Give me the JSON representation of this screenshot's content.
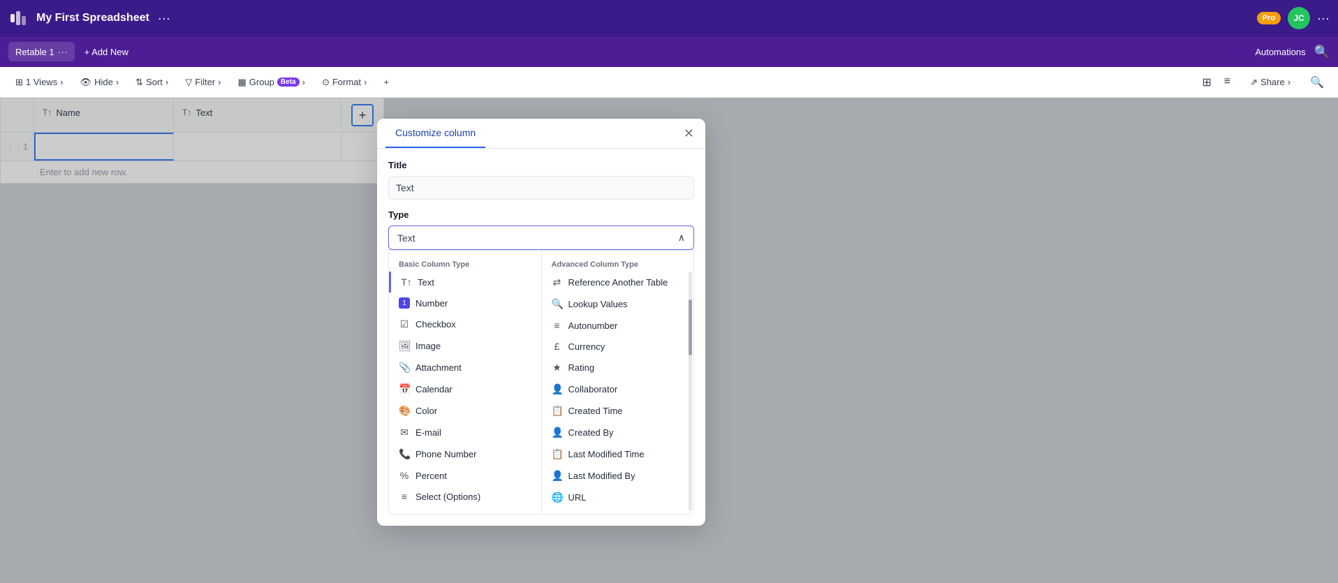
{
  "app": {
    "title": "My First Spreadsheet",
    "dots_label": "···",
    "logo_alt": "Retable logo"
  },
  "topbar": {
    "pro_badge": "Pro",
    "avatar_initials": "JC",
    "more_dots": "···"
  },
  "tabs": {
    "current_tab": "Retable 1",
    "current_tab_dots": "···",
    "add_new": "+ Add New",
    "automations": "Automations"
  },
  "toolbar": {
    "views": "1 Views",
    "hide": "Hide",
    "sort": "Sort",
    "filter": "Filter",
    "group": "Group",
    "group_badge": "Beta",
    "format": "Format",
    "add_icon": "+",
    "share": "Share"
  },
  "table": {
    "col_name": "Name",
    "col_text": "Text",
    "add_col_label": "+",
    "row_number": "1",
    "add_row_hint": "Enter to add new row."
  },
  "modal": {
    "tab_label": "Customize column",
    "close_icon": "✕",
    "title_label": "Title",
    "title_value": "Text",
    "type_label": "Type",
    "type_value": "Text",
    "chevron_up": "∧",
    "basic_section_title": "Basic Column Type",
    "advanced_section_title": "Advanced Column Type",
    "basic_items": [
      {
        "icon": "T↑",
        "label": "Text",
        "active": true
      },
      {
        "icon": "1",
        "label": "Number"
      },
      {
        "icon": "✓",
        "label": "Checkbox"
      },
      {
        "icon": "🖼",
        "label": "Image"
      },
      {
        "icon": "📎",
        "label": "Attachment"
      },
      {
        "icon": "📅",
        "label": "Calendar"
      },
      {
        "icon": "🎨",
        "label": "Color"
      },
      {
        "icon": "✉",
        "label": "E-mail"
      },
      {
        "icon": "📞",
        "label": "Phone Number"
      },
      {
        "icon": "%",
        "label": "Percent"
      },
      {
        "icon": "≡",
        "label": "Select (Options)"
      }
    ],
    "advanced_items": [
      {
        "icon": "⇄",
        "label": "Reference Another Table"
      },
      {
        "icon": "🔍",
        "label": "Lookup Values"
      },
      {
        "icon": "#",
        "label": "Autonumber"
      },
      {
        "icon": "£",
        "label": "Currency"
      },
      {
        "icon": "★",
        "label": "Rating"
      },
      {
        "icon": "👤",
        "label": "Collaborator"
      },
      {
        "icon": "📋",
        "label": "Created Time"
      },
      {
        "icon": "👤",
        "label": "Created By"
      },
      {
        "icon": "📋",
        "label": "Last Modified Time"
      },
      {
        "icon": "👤",
        "label": "Last Modified By"
      },
      {
        "icon": "🌐",
        "label": "URL"
      }
    ]
  }
}
